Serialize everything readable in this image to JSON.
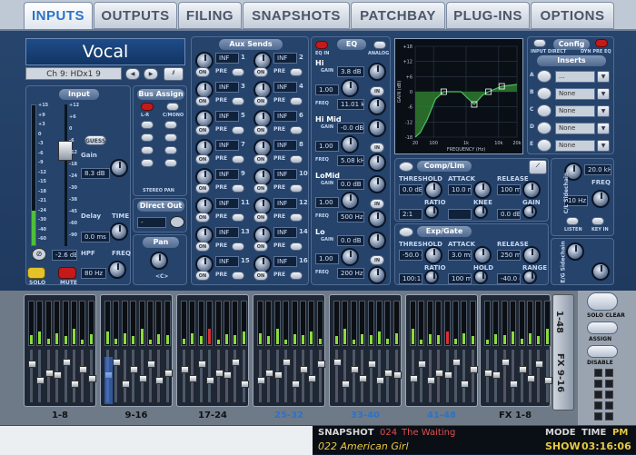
{
  "tabs": [
    "INPUTS",
    "OUTPUTS",
    "FILING",
    "SNAPSHOTS",
    "PATCHBAY",
    "PLUG-INS",
    "OPTIONS"
  ],
  "active_tab": "INPUTS",
  "channel": {
    "name": "Vocal",
    "selector": "Ch 9: HDx1 9"
  },
  "input": {
    "title": "Input",
    "meter_scale": [
      "+15",
      "+9",
      "+3",
      "0",
      "-3",
      "-6",
      "-9",
      "-12",
      "-15",
      "-18",
      "-21",
      "-24",
      "-30",
      "-40",
      "-60"
    ],
    "fader_scale": [
      "+12",
      "+6",
      "0",
      "-6",
      "-12",
      "-18",
      "-24",
      "-30",
      "-38",
      "-45",
      "-60",
      "-90"
    ],
    "guess": "GUESS",
    "gain_label": "Gain",
    "gain_value": "8.3 dB",
    "trim_value": "-2.6 dB",
    "delay_label": "Delay",
    "delay_time": "TIME",
    "delay_value": "0.0 ms",
    "hpf_label": "HPF",
    "hpf_freq": "FREQ",
    "hpf_value": "80 Hz",
    "solo": "SOLO",
    "mute": "MUTE"
  },
  "bus_assign": {
    "title": "Bus Assign",
    "lr": "L-R",
    "cmono": "C/MONO",
    "stereo_pan": "STEREO PAN",
    "direct_out": "Direct Out",
    "direct_value": "-",
    "pan": "Pan",
    "pan_value": "<C>"
  },
  "aux_sends": {
    "title": "Aux Sends",
    "on": "ON",
    "pre": "PRE",
    "rows": [
      {
        "l": "1",
        "r": "2",
        "lv": "INF",
        "rv": "INF"
      },
      {
        "l": "3",
        "r": "4",
        "lv": "INF",
        "rv": "INF"
      },
      {
        "l": "5",
        "r": "6",
        "lv": "INF",
        "rv": "INF"
      },
      {
        "l": "7",
        "r": "8",
        "lv": "INF",
        "rv": "INF"
      },
      {
        "l": "9",
        "r": "10",
        "lv": "INF",
        "rv": "INF"
      },
      {
        "l": "11",
        "r": "12",
        "lv": "INF",
        "rv": "INF"
      },
      {
        "l": "13",
        "r": "14",
        "lv": "INF",
        "rv": "INF"
      },
      {
        "l": "15",
        "r": "16",
        "lv": "INF",
        "rv": "INF"
      }
    ]
  },
  "eq": {
    "title": "EQ",
    "eq_in": "EQ IN",
    "analog": "ANALOG",
    "in": "IN",
    "gain": "GAIN",
    "freq": "FREQ",
    "q": "Q",
    "bands": [
      {
        "name": "Hi",
        "gain": "3.8 dB",
        "q": "1.00",
        "freq": "11.01 kHz"
      },
      {
        "name": "Hi Mid",
        "gain": "-0.0 dB",
        "q": "1.00",
        "freq": "5.08 kHz"
      },
      {
        "name": "LoMid",
        "gain": "0.0 dB",
        "q": "1.00",
        "freq": "500 Hz"
      },
      {
        "name": "Lo",
        "gain": "0.0 dB",
        "q": "1.00",
        "freq": "200 Hz"
      }
    ],
    "graph_y": [
      "+18",
      "+12",
      "+6",
      "0",
      "-6",
      "-12",
      "-18"
    ],
    "graph_x": [
      "20",
      "100",
      "1k",
      "10k",
      "20k"
    ],
    "graph_xlabel": "FREQUENCY (Hz)",
    "graph_ylabel": "GAIN (dB)"
  },
  "config": {
    "title": "Config",
    "input_direct": "INPUT DIRECT",
    "dyn_pre_eq": "DYN PRE EQ",
    "inserts": "Inserts",
    "slots": [
      "...",
      "None",
      "None",
      "None",
      "None"
    ],
    "labels": [
      "A",
      "B",
      "C",
      "D",
      "E"
    ]
  },
  "comp": {
    "title": "Comp/Lim",
    "threshold": "THRESHOLD",
    "attack": "ATTACK",
    "release": "RELEASE",
    "ratio": "RATIO",
    "knee": "KNEE",
    "gain": "GAIN",
    "thr_v": "0.0 dB",
    "att_v": "10.0 ms",
    "rel_v": "100 ms",
    "ratio_v": "2:1",
    "knee_v": "",
    "gain_v": "0.0 dB",
    "freq_v": "20.0 kHz",
    "sc_label": "C/L Sidechain",
    "freq": "FREQ",
    "hz_v": "10 Hz",
    "listen": "LISTEN",
    "key_in": "KEY IN"
  },
  "gate": {
    "title": "Exp/Gate",
    "threshold": "THRESHOLD",
    "attack": "ATTACK",
    "release": "RELEASE",
    "ratio": "RATIO",
    "hold": "HOLD",
    "range": "RANGE",
    "thr_v": "-50.0 dB",
    "att_v": "3.0 ms",
    "rel_v": "250 ms",
    "ratio_v": "100:1",
    "hold_v": "100 ms",
    "range_v": "-40.0 dB",
    "sc_label": "E/G Sidechain"
  },
  "bank": {
    "groups": [
      "1-8",
      "9-16",
      "17-24",
      "25-32",
      "33-40",
      "41-48",
      "FX 1-8"
    ],
    "highlight": [
      false,
      false,
      false,
      true,
      true,
      true,
      false
    ],
    "side_a": "1-48",
    "side_b": "FX 9-16",
    "solo_clear": "SOLO CLEAR",
    "assign": "ASSIGN",
    "disable": "DISABLE"
  },
  "status": {
    "snapshot_label": "SNAPSHOT",
    "snapshot_num": "024",
    "snapshot_name": "The Waiting",
    "next_snapshot": "022 American Girl",
    "mode_label": "MODE",
    "mode_value": "SHOW",
    "time_label": "TIME",
    "ampm": "PM",
    "time_value": "03:16:06"
  },
  "colors": {
    "accent": "#2b73c9",
    "meter": "#8bdc3c",
    "eq_curve": "#49c060",
    "mute": "#c61a1a",
    "solo": "#e6c229"
  }
}
